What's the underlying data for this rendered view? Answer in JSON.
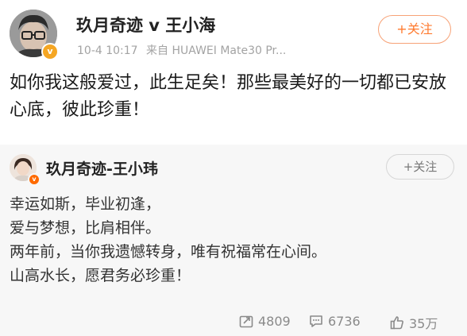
{
  "post": {
    "author": "玖月奇迹 v 王小海",
    "timestamp": "10-4 10:17",
    "source": "来自 HUAWEI Mate30 Pr...",
    "follow_label": "+关注",
    "text": "如你我这般爱过，此生足矣！那些最美好的一切都已安放心底，彼此珍重！"
  },
  "repost": {
    "author": "玖月奇迹-王小玮",
    "follow_label": "+关注",
    "lines": [
      "幸运如斯，毕业初逢，",
      "爱与梦想，比肩相伴。",
      "两年前，当你我遗憾转身，唯有祝福常在心间。",
      "山高水长，愿君务必珍重！"
    ],
    "stats": {
      "reposts": "4809",
      "comments": "6736",
      "likes": "35万"
    }
  },
  "icons": {
    "verified_badge": "verified-v-icon",
    "repost": "repost-icon",
    "comment": "comment-icon",
    "like": "thumbs-up-icon"
  },
  "colors": {
    "accent": "#ff7a2e",
    "verified_gold": "#f5a623",
    "verified_orange": "#ff6a00",
    "repost_bg": "#f7f7f7",
    "meta_gray": "#a3a3a3"
  }
}
